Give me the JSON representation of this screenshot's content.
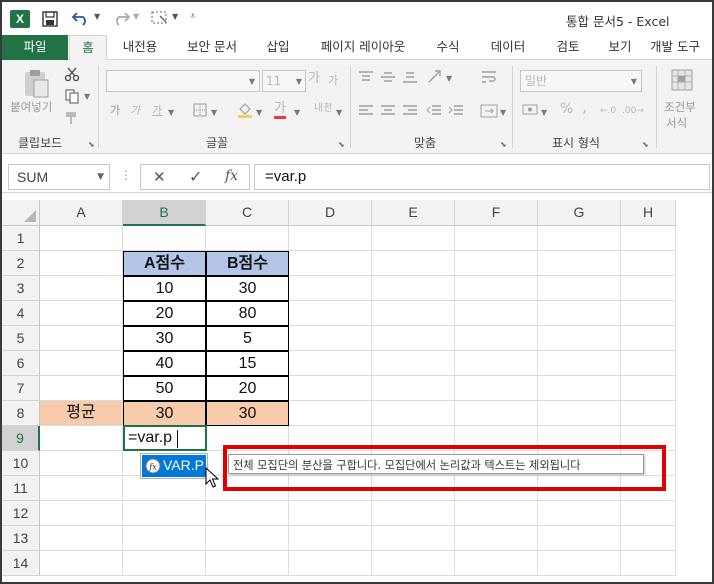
{
  "app": {
    "title": "통합 문서5 - Excel",
    "excel_badge": "X"
  },
  "tabs": [
    "파일",
    "홈",
    "내전용",
    "보안 문서",
    "삽입",
    "페이지 레이아웃",
    "수식",
    "데이터",
    "검토",
    "보기",
    "개발 도구"
  ],
  "ribbon": {
    "clipboard": {
      "paste": "붙여넣기",
      "label": "클립보드"
    },
    "font": {
      "size": "11",
      "label": "글꼴",
      "bold": "가",
      "italic": "가",
      "underline": "가",
      "char_a": "가",
      "grow": "가",
      "shrink": "가",
      "phonetic": "내천"
    },
    "alignment": {
      "label": "맞춤"
    },
    "number": {
      "format": "일반",
      "label": "표시 형식",
      "percent": "%"
    },
    "styles": {
      "conditional": "조건부",
      "conditional2": "서식"
    }
  },
  "formula_bar": {
    "name_box": "SUM",
    "formula": "=var.p"
  },
  "grid": {
    "columns": [
      "A",
      "B",
      "C",
      "D",
      "E",
      "F",
      "G",
      "H"
    ],
    "rows": [
      "1",
      "2",
      "3",
      "4",
      "5",
      "6",
      "7",
      "8",
      "9",
      "10",
      "11",
      "12",
      "13",
      "14"
    ],
    "table": {
      "headers": [
        "A점수",
        "B점수"
      ],
      "rows": [
        [
          "10",
          "30"
        ],
        [
          "20",
          "80"
        ],
        [
          "30",
          "5"
        ],
        [
          "40",
          "15"
        ],
        [
          "50",
          "20"
        ]
      ],
      "avg_label": "평균",
      "avg_values": [
        "30",
        "30"
      ]
    },
    "editing_cell_text": "=var.p"
  },
  "autocomplete": {
    "item": "VAR.P",
    "tooltip": "전체 모집단의 분산을 구합니다. 모집단에서 논리값과 텍스트는 제외됩니다"
  },
  "colors": {
    "excel_green": "#217346",
    "header_blue": "#b4c6e7",
    "avg_orange": "#f8cbad",
    "highlight_red": "#e00000",
    "selection_blue": "#0078d7"
  }
}
